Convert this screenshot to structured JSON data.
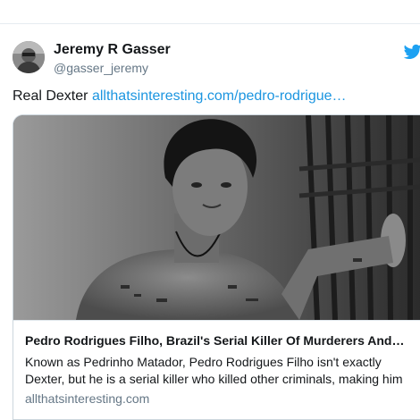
{
  "tweet": {
    "author": {
      "name": "Jeremy R Gasser",
      "handle": "@gasser_jeremy"
    },
    "text": "Real Dexter",
    "link_text": "allthatsinteresting.com/pedro-rodrigue…",
    "card": {
      "title": "Pedro Rodrigues Filho, Brazil's Serial Killer Of Murderers And…",
      "description_lines": [
        "Known as Pedrinho Matador, Pedro Rodrigues Filho isn't exactly",
        "Dexter, but he is a serial killer who killed other criminals, making him"
      ],
      "domain": "allthatsinteresting.com"
    }
  },
  "icons": {
    "brand": "twitter-bird-icon",
    "brand_color": "#1da1f2"
  },
  "colors": {
    "link": "#1b95e0",
    "text": "#14171a",
    "secondary": "#657786",
    "border": "#ccd6dd"
  }
}
